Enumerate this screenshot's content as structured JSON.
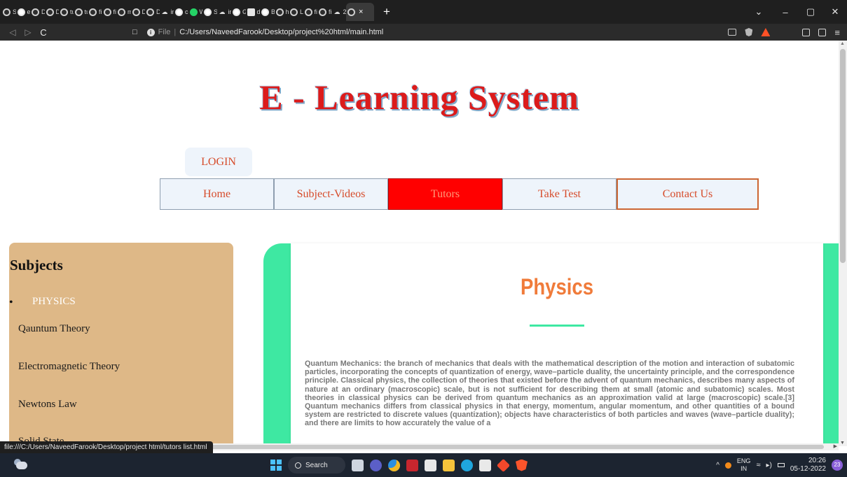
{
  "browser": {
    "tabs": [
      {
        "label": "Stu",
        "icon": "globe-icon"
      },
      {
        "label": "e le",
        "icon": "google-icon"
      },
      {
        "label": "Doc",
        "icon": "globe-icon"
      },
      {
        "label": "Doc",
        "icon": "globe-icon"
      },
      {
        "label": "tuto",
        "icon": "globe-icon"
      },
      {
        "label": "tuto",
        "icon": "globe-icon"
      },
      {
        "label": "file:",
        "icon": "globe-icon"
      },
      {
        "label": "file:",
        "icon": "globe-icon"
      },
      {
        "label": "mai",
        "icon": "globe-icon"
      },
      {
        "label": "Doc",
        "icon": "globe-icon"
      },
      {
        "label": "Doc",
        "icon": "globe-icon"
      },
      {
        "label": "inte",
        "icon": "cloud-icon"
      },
      {
        "label": "cop",
        "icon": "google-icon"
      },
      {
        "label": "Wh",
        "icon": "whatsapp-icon"
      },
      {
        "label": "Sig",
        "icon": "google-icon"
      },
      {
        "label": "inte",
        "icon": "cloud-icon"
      },
      {
        "label": "Go",
        "icon": "google-icon"
      },
      {
        "label": "doc",
        "icon": "doc-icon"
      },
      {
        "label": "Ber",
        "icon": "google-icon"
      },
      {
        "label": "htm",
        "icon": "globe-icon"
      },
      {
        "label": "Log",
        "icon": "globe-icon"
      },
      {
        "label": "file",
        "icon": "globe-icon"
      },
      {
        "label": "file",
        "icon": "globe-icon"
      },
      {
        "label": "240",
        "icon": "cloud-icon"
      }
    ],
    "active_tab_close": "×",
    "new_tab": "+",
    "window_controls": {
      "dropdown": "⌄",
      "minimize": "–",
      "maximize": "▢",
      "close": "✕"
    },
    "nav": {
      "back": "◁",
      "forward": "▷",
      "reload": "C"
    },
    "url_scheme": "File",
    "url_separator": "|",
    "url": "C:/Users/NaveedFarook/Desktop/project%20html/main.html"
  },
  "page": {
    "title": "E - Learning System",
    "login_label": "LOGIN",
    "nav_items": [
      {
        "label": "Home"
      },
      {
        "label": "Subject-Videos"
      },
      {
        "label": "Tutors"
      },
      {
        "label": "Take Test"
      },
      {
        "label": "Contact Us"
      }
    ],
    "sidebar": {
      "title": "Subjects",
      "bullet": "•",
      "category": "PHYSICS",
      "links": [
        "Qauntum Theory",
        "Electromagnetic Theory",
        "Newtons Law",
        "Solid State"
      ]
    },
    "content": {
      "heading": "Physics",
      "body": "Quantum Mechanics: the branch of mechanics that deals with the mathematical description of the motion and interaction of subatomic particles, incorporating the concepts of quantization of energy, wave–particle duality, the uncertainty principle, and the correspondence principle. Classical physics, the collection of theories that existed before the advent of quantum mechanics, describes many aspects of nature at an ordinary (macroscopic) scale, but is not sufficient for describing them at small (atomic and subatomic) scales. Most theories in classical physics can be derived from quantum mechanics as an approximation valid at large (macroscopic) scale.[3] Quantum mechanics differs from classical physics in that energy, momentum, angular momentum, and other quantities of a bound system are restricted to discrete values (quantization); objects have characteristics of both particles and waves (wave–particle duality); and there are limits to how accurately the value of a"
    },
    "status_url": "file:///C:/Users/NaveedFarook/Desktop/project html/tutors list.html"
  },
  "taskbar": {
    "search_label": "Search",
    "lang_line1": "ENG",
    "lang_line2": "IN",
    "time": "20:26",
    "date": "05-12-2022",
    "notification_count": "23",
    "tray_chevron": "^"
  },
  "colors": {
    "title_red": "#dc1b1b",
    "nav_text": "#d64b2a",
    "nav_active_bg": "#ff0000",
    "sidebar_bg": "#deb887",
    "card_accent": "#3ee8a2",
    "heading_orange": "#f07b3a"
  }
}
